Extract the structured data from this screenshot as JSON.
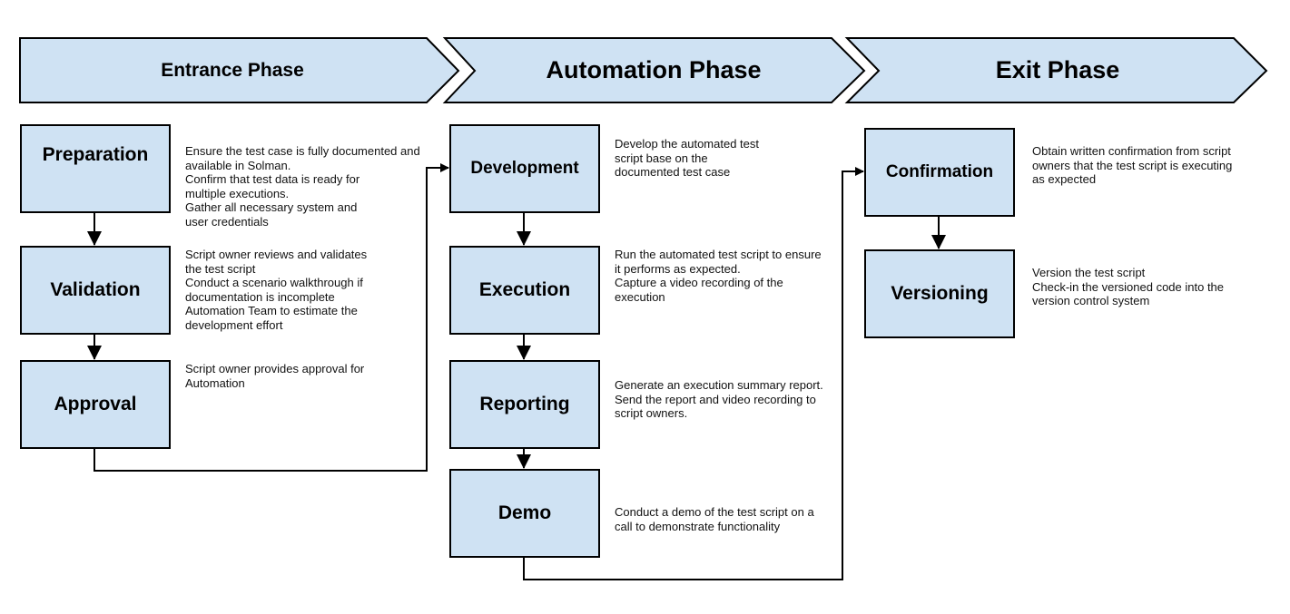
{
  "colors": {
    "box_fill": "#cfe2f3",
    "stroke": "#000000"
  },
  "phases": [
    {
      "title": "Entrance Phase"
    },
    {
      "title": "Automation Phase"
    },
    {
      "title": "Exit Phase"
    }
  ],
  "steps": {
    "preparation": {
      "label": "Preparation",
      "desc": [
        "Ensure the test case is fully documented and",
        "available in Solman.",
        "Confirm that test data is ready for",
        "multiple executions.",
        "Gather all necessary system and",
        "user credentials"
      ]
    },
    "validation": {
      "label": "Validation",
      "desc": [
        "Script owner reviews and validates",
        "the test script",
        "Conduct a scenario walkthrough if",
        "documentation is incomplete",
        "Automation Team to estimate the",
        "development effort"
      ]
    },
    "approval": {
      "label": "Approval",
      "desc": [
        "Script owner provides approval for",
        "Automation"
      ]
    },
    "development": {
      "label": "Development",
      "desc": [
        "Develop the automated test",
        "script base on the",
        "documented test case"
      ]
    },
    "execution": {
      "label": "Execution",
      "desc": [
        "Run the automated test script to ensure",
        "it performs as expected.",
        "Capture a video recording of the",
        "execution"
      ]
    },
    "reporting": {
      "label": "Reporting",
      "desc": [
        "Generate an execution summary report.",
        "Send the report and video recording to",
        "script owners."
      ]
    },
    "demo": {
      "label": "Demo",
      "desc": [
        "Conduct a demo of the test script on a",
        "call to demonstrate functionality"
      ]
    },
    "confirmation": {
      "label": "Confirmation",
      "desc": [
        "Obtain written confirmation from script",
        "owners that the test script is executing",
        "as expected"
      ]
    },
    "versioning": {
      "label": "Versioning",
      "desc": [
        "Version the test script",
        "Check-in the versioned code into the",
        "version control system"
      ]
    }
  }
}
